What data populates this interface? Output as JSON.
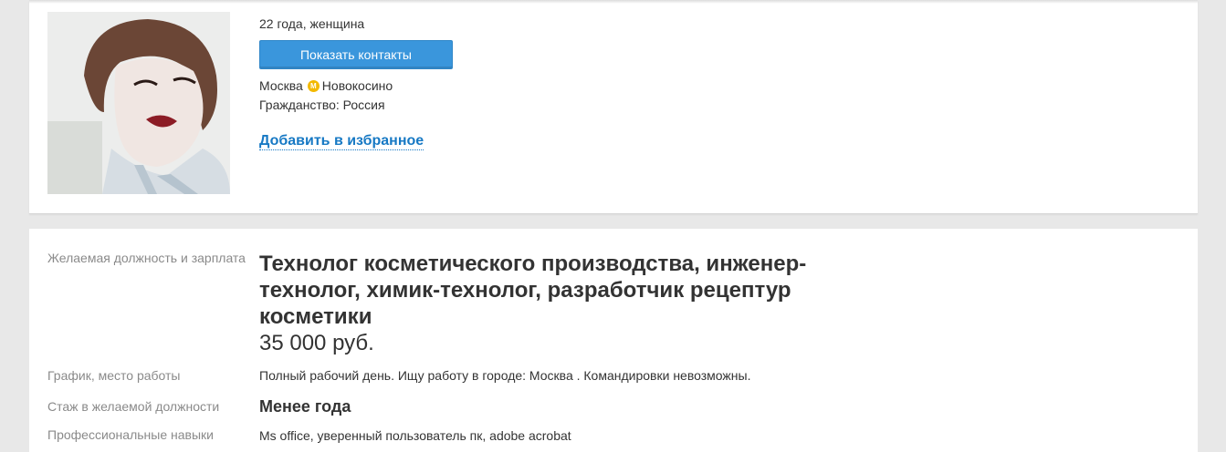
{
  "profile": {
    "age_gender": "22 года, женщина",
    "show_contacts_label": "Показать контакты",
    "city": "Москва",
    "metro_icon_letter": "М",
    "metro_station": "Новокосино",
    "citizenship": "Гражданство: Россия",
    "add_favorite_label": "Добавить в избранное",
    "metro_color": "#f3b900",
    "button_color": "#3a96dc",
    "link_color": "#1779c4"
  },
  "resume": {
    "position_label": "Желаемая должность и зарплата",
    "position_title": "Технолог косметического производства, инженер-технолог, химик-технолог, разработчик рецептур косметики",
    "salary": "35 000 руб.",
    "schedule_label": "График, место работы",
    "schedule_value": "Полный рабочий день. Ищу работу в городе: Москва . Командировки невозможны.",
    "experience_label": "Стаж в желаемой должности",
    "experience_value": "Менее года",
    "skills_label": "Профессиональные навыки",
    "skills_value": "Ms office, уверенный пользователь пк, adobe acrobat"
  }
}
